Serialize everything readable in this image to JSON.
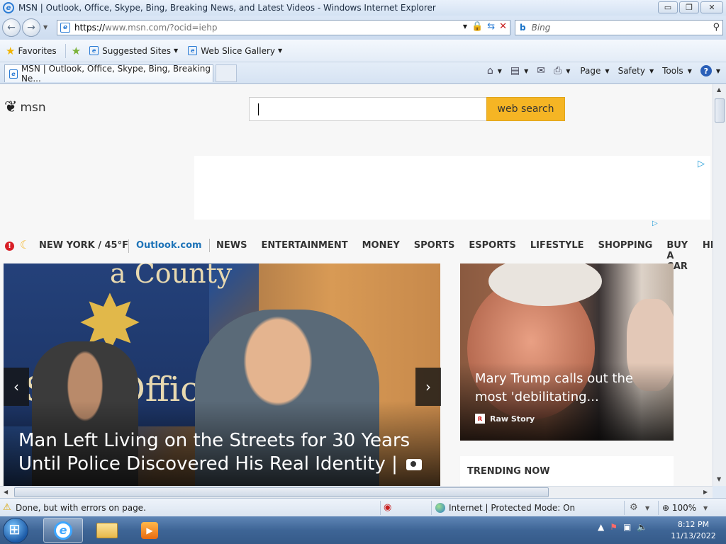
{
  "window": {
    "title": "MSN | Outlook, Office, Skype, Bing, Breaking News, and Latest Videos - Windows Internet Explorer",
    "minimize": "▭",
    "restore": "❐",
    "close": "✕"
  },
  "address_bar": {
    "url_prefix": "https://",
    "url_domain": "www.msn.com",
    "url_rest": "/?ocid=iehp",
    "search_placeholder": "Bing"
  },
  "favorites_bar": {
    "favorites_label": "Favorites",
    "suggested_sites": "Suggested Sites",
    "web_slice_gallery": "Web Slice Gallery"
  },
  "tabs": [
    {
      "label": "MSN | Outlook, Office, Skype, Bing, Breaking Ne..."
    }
  ],
  "command_bar": {
    "page": "Page",
    "safety": "Safety",
    "tools": "Tools",
    "help": "?"
  },
  "msn": {
    "logo_text": "msn",
    "search_button": "web search",
    "weather": "NEW YORK / 45°F",
    "nav_links": [
      "Outlook.com",
      "NEWS",
      "ENTERTAINMENT",
      "MONEY",
      "SPORTS",
      "ESPORTS",
      "LIFESTYLE",
      "SHOPPING",
      "BUY A CAR",
      "HEALTH"
    ],
    "hero": {
      "wall_text": "Sher  Office",
      "wall_text_top": "a County",
      "caption": "Man Left Living on the Streets for 30 Years Until Police Discovered His Real Identity |"
    },
    "side_story": {
      "caption": "Mary Trump calls out the most 'debilitating...",
      "source": "Raw Story",
      "source_logo": "R"
    },
    "trending_heading": "TRENDING NOW"
  },
  "status_bar": {
    "status_text": "Done, but with errors on page.",
    "zone": "Internet | Protected Mode: On",
    "zoom": "100%"
  },
  "taskbar": {
    "time": "8:12 PM",
    "date": "11/13/2022"
  },
  "colors": {
    "accent_search": "#f5b524",
    "outlook_link": "#1f74b8",
    "alert": "#d81f26"
  },
  "icons": {
    "browser": "ie-icon",
    "favorites": "star-icon",
    "bing": "bing-icon",
    "search": "magnifier-icon",
    "home": "home-icon",
    "feeds": "rss-icon",
    "print": "printer-icon",
    "help": "help-icon",
    "alert": "alert-icon",
    "weather": "moon-icon",
    "camera": "camera-icon"
  }
}
